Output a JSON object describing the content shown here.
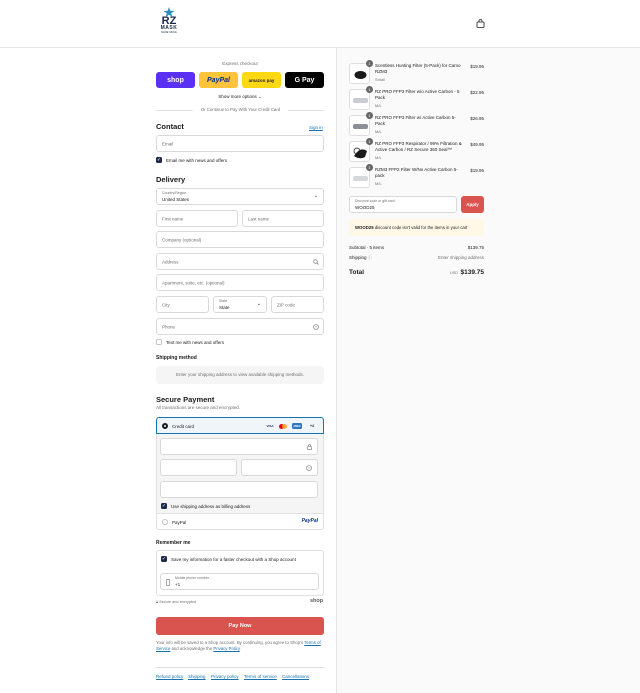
{
  "header": {
    "logo_rz": "RZ",
    "logo_mask": "MASK",
    "logo_tag": "MADE SINCE",
    "cart_icon": "shopping-bag-icon"
  },
  "express": {
    "label": "Express checkout",
    "shop": "shop",
    "paypal": "PayPal",
    "amazon": "amazon pay",
    "gpay": "G Pay",
    "show_more": "Show more options",
    "continue_label": "Or Continue to Pay With Your Credit Card"
  },
  "contact": {
    "title": "Contact",
    "signin": "Sign in",
    "email_placeholder": "Email",
    "email_news": "Email me with news and offers"
  },
  "delivery": {
    "title": "Delivery",
    "country_label": "Country/Region",
    "country_value": "United States",
    "first_name": "First name",
    "last_name": "Last name",
    "company": "Company (optional)",
    "address": "Address",
    "apartment": "Apartment, suite, etc. (optional)",
    "city": "City",
    "state_label": "State",
    "state_value": "State",
    "zip": "ZIP code",
    "phone": "Phone",
    "text_news": "Text me with news and offers"
  },
  "shipping": {
    "title": "Shipping method",
    "message": "Enter your shipping address to view available shipping methods."
  },
  "payment": {
    "title": "Secure Payment",
    "subtitle": "All transactions are secure and encrypted.",
    "credit_card": "Credit card",
    "cards": [
      "VISA",
      "MC",
      "AMEX",
      "+4"
    ],
    "use_shipping": "Use shipping address as billing address",
    "paypal": "PayPal",
    "paypal_logo": "PayPal"
  },
  "remember": {
    "title": "Remember me",
    "save_info": "Save my information for a faster checkout with a Shop account",
    "phone_label": "Mobile phone number",
    "phone_value": "+1",
    "secure": "Secure and encrypted",
    "shop": "shop"
  },
  "pay_button": "Pay Now",
  "legal": {
    "line1": "Your info will be saved to a Shop account. By continuing, you agree to Shop's",
    "terms": "Terms of Service",
    "and": "and acknowledge the",
    "privacy": "Privacy Policy",
    "period": "."
  },
  "footer": [
    "Refund policy",
    "Shipping",
    "Privacy policy",
    "Terms of service",
    "Cancellations"
  ],
  "cart": {
    "items": [
      {
        "qty": "1",
        "title": "Scentless Hunting Filter (5-Pack) for Camo RZM3",
        "variant": "Small",
        "price": "$19.95"
      },
      {
        "qty": "1",
        "title": "RZ PRO FFP3 Filter w/o Active Carbon - 5 Pack",
        "variant": "M/L",
        "price": "$22.95"
      },
      {
        "qty": "1",
        "title": "RZ PRO FFP3 Filter w/ Active Carbon 5-Pack",
        "variant": "M/L",
        "price": "$26.95"
      },
      {
        "qty": "1",
        "title": "RZ PRO FFP3 Respirator / 99% Filtration & Active Carbon / RZ Secure 360 Seal™",
        "variant": "M/L",
        "price": "$49.95"
      },
      {
        "qty": "1",
        "title": "RZM3 FFP2 Filter W/No Active Carbon 5-pack",
        "variant": "M/L",
        "price": "$19.95"
      }
    ],
    "discount_label": "Discount code or gift card",
    "discount_value": "WOOD25",
    "apply": "Apply",
    "error_code": "WOOD25",
    "error_text": "discount code isn't valid for the items in your cart",
    "subtotal_label": "Subtotal · 5 items",
    "subtotal_value": "$139.75",
    "shipping_label": "Shipping",
    "shipping_value": "Enter shipping address",
    "total_label": "Total",
    "currency": "USD",
    "total_value": "$139.75"
  },
  "colors": {
    "accent_blue": "#1773b0",
    "pay_button": "#d9534f",
    "shop_purple": "#5a31f4",
    "paypal_yellow": "#ffc439",
    "navy": "#1e2a4a",
    "error_bg": "#fff8e6"
  }
}
